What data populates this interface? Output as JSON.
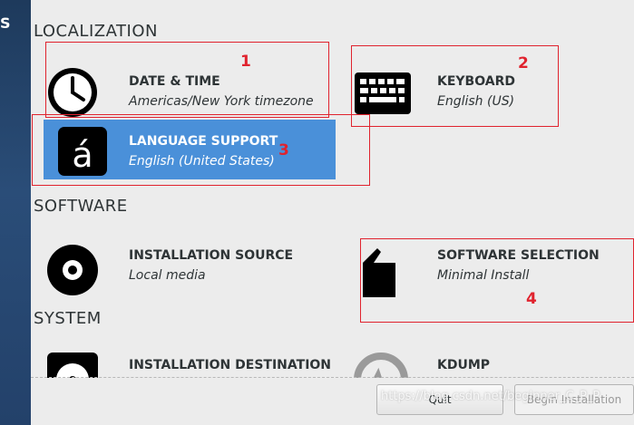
{
  "sidebar": {
    "logo_text": "S"
  },
  "sections": {
    "localization": "LOCALIZATION",
    "software": "SOFTWARE",
    "system": "SYSTEM"
  },
  "spokes": {
    "date_time": {
      "title": "DATE & TIME",
      "status": "Americas/New York timezone"
    },
    "keyboard": {
      "title": "KEYBOARD",
      "status": "English (US)"
    },
    "language_support": {
      "title": "LANGUAGE SUPPORT",
      "status": "English (United States)"
    },
    "installation_source": {
      "title": "INSTALLATION SOURCE",
      "status": "Local media"
    },
    "software_selection": {
      "title": "SOFTWARE SELECTION",
      "status": "Minimal Install"
    },
    "installation_destination": {
      "title": "INSTALLATION DESTINATION"
    },
    "kdump": {
      "title": "KDUMP"
    }
  },
  "annotations": {
    "n1": "1",
    "n2": "2",
    "n3": "3",
    "n4": "4"
  },
  "buttons": {
    "quit": "Quit",
    "begin": "Begin Installation"
  },
  "watermark": "https://blog.csdn.net/beginner_C_P_P",
  "colors": {
    "sidebar": "#23416a",
    "selected": "#4a90d9",
    "annotation": "#e0232e"
  }
}
